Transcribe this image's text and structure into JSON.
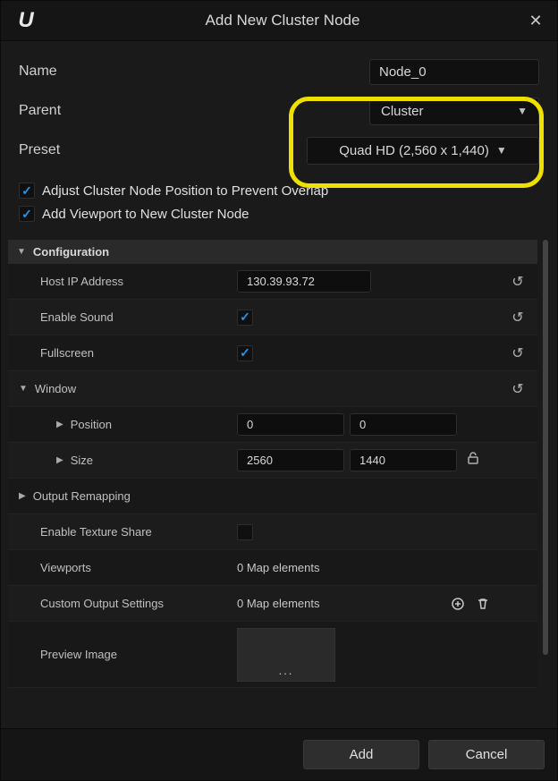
{
  "title": "Add New Cluster Node",
  "top": {
    "name_label": "Name",
    "name_value": "Node_0",
    "parent_label": "Parent",
    "parent_value": "Cluster",
    "preset_label": "Preset",
    "preset_value": "Quad HD (2,560 x 1,440)"
  },
  "options": {
    "adjust": "Adjust Cluster Node Position to Prevent Overlap",
    "addviewport": "Add Viewport to New Cluster Node"
  },
  "sections": {
    "config_header": "Configuration",
    "host_ip_label": "Host IP Address",
    "host_ip_value": "130.39.93.72",
    "enable_sound_label": "Enable Sound",
    "fullscreen_label": "Fullscreen",
    "window_header": "Window",
    "position_label": "Position",
    "position_x": "0",
    "position_y": "0",
    "size_label": "Size",
    "size_w": "2560",
    "size_h": "1440",
    "output_remap_label": "Output Remapping",
    "texture_share_label": "Enable Texture Share",
    "viewports_label": "Viewports",
    "viewports_value": "0 Map elements",
    "custom_output_label": "Custom Output Settings",
    "custom_output_value": "0 Map elements",
    "preview_label": "Preview Image",
    "preview_dots": "..."
  },
  "footer": {
    "add": "Add",
    "cancel": "Cancel"
  }
}
